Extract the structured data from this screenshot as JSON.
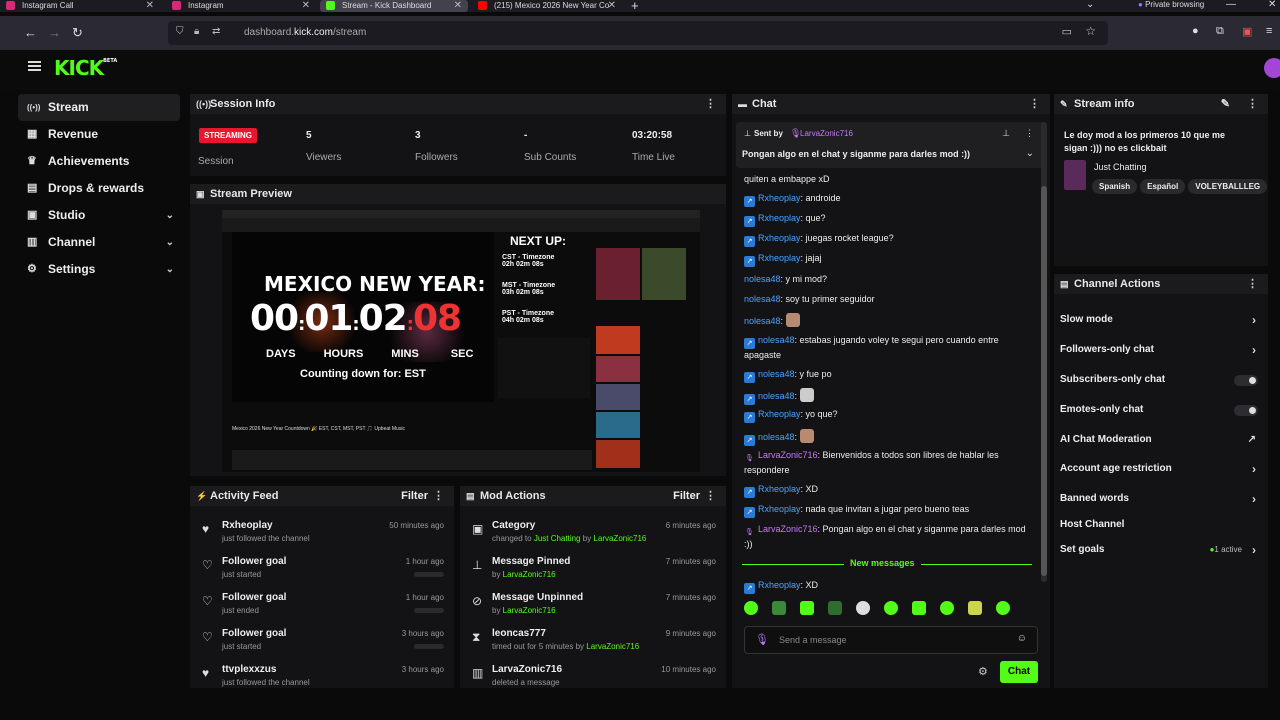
{
  "browser": {
    "tabs": [
      {
        "title": "Instagram Call",
        "color": "#d62976"
      },
      {
        "title": "Instagram",
        "color": "#d62976"
      },
      {
        "title": "Stream - Kick Dashboard",
        "color": "#53fc18"
      },
      {
        "title": "(215) Mexico 2026 New Year Co",
        "color": "#ff0000"
      }
    ],
    "private_label": "Private browsing",
    "url_host": "dashboard.",
    "url_domain": "kick.com",
    "url_path": "/stream"
  },
  "header": {
    "logo": "KICK",
    "logo_sup": "BETA"
  },
  "sidebar": {
    "items": [
      {
        "label": "Stream",
        "icon": "stream-icon",
        "glyph": "((•))"
      },
      {
        "label": "Revenue",
        "icon": "revenue-icon",
        "glyph": "▦"
      },
      {
        "label": "Achievements",
        "icon": "trophy-icon",
        "glyph": "🏆"
      },
      {
        "label": "Drops & rewards",
        "icon": "gift-icon",
        "glyph": "🎁"
      },
      {
        "label": "Studio",
        "icon": "studio-icon",
        "glyph": "▣"
      },
      {
        "label": "Channel",
        "icon": "channel-icon",
        "glyph": "▤"
      },
      {
        "label": "Settings",
        "icon": "gear-icon",
        "glyph": "⚙"
      }
    ]
  },
  "session": {
    "title": "Session Info",
    "badge": "STREAMING",
    "session_label": "Session",
    "stats": [
      {
        "value": "5",
        "label": "Viewers"
      },
      {
        "value": "3",
        "label": "Followers"
      },
      {
        "value": "-",
        "label": "Sub Counts"
      },
      {
        "value": "03:20:58",
        "label": "Time Live"
      }
    ]
  },
  "preview": {
    "title": "Stream Preview",
    "headline": "MEXICO NEW YEAR:",
    "countdown": [
      "00",
      "01",
      "02",
      "08"
    ],
    "units": [
      "DAYS",
      "HOURS",
      "MINS",
      "SEC"
    ],
    "counting": "Counting down for: EST",
    "next_up": "NEXT UP:",
    "zones": [
      {
        "name": "CST - Timezone",
        "time": "02h 02m 08s"
      },
      {
        "name": "MST - Timezone",
        "time": "03h 02m 08s"
      },
      {
        "name": "PST - Timezone",
        "time": "04h 02m 08s"
      }
    ],
    "video_title": "Mexico 2026 New Year Countdown 🎉 EST, CST, MST, PST 🎵 Upbeat Music"
  },
  "activity": {
    "title": "Activity Feed",
    "filter": "Filter",
    "items": [
      {
        "title": "Rxheoplay",
        "sub": "just followed the channel",
        "time": "50 minutes ago",
        "icon": "heart-filled-icon",
        "glyph": "♥"
      },
      {
        "title": "Follower goal",
        "sub": "just started",
        "time": "1 hour ago",
        "icon": "heart-icon",
        "glyph": "♡"
      },
      {
        "title": "Follower goal",
        "sub": "just ended",
        "time": "1 hour ago",
        "icon": "heart-icon",
        "glyph": "♡"
      },
      {
        "title": "Follower goal",
        "sub": "just started",
        "time": "3 hours ago",
        "icon": "heart-icon",
        "glyph": "♡"
      },
      {
        "title": "ttvplexxzus",
        "sub": "just followed the channel",
        "time": "3 hours ago",
        "icon": "heart-filled-icon",
        "glyph": "♥"
      }
    ]
  },
  "mod": {
    "title": "Mod Actions",
    "filter": "Filter",
    "items": [
      {
        "title": "Category",
        "pre": "changed to ",
        "hl1": "Just Chatting",
        "mid": " by ",
        "hl2": "LarvaZonic716",
        "time": "6 minutes ago",
        "icon": "category-icon",
        "glyph": "▣"
      },
      {
        "title": "Message Pinned",
        "pre": "by ",
        "hl1": "LarvaZonic716",
        "mid": "",
        "hl2": "",
        "time": "7 minutes ago",
        "icon": "pin-icon",
        "glyph": "📌"
      },
      {
        "title": "Message Unpinned",
        "pre": "by ",
        "hl1": "LarvaZonic716",
        "mid": "",
        "hl2": "",
        "time": "7 minutes ago",
        "icon": "unpin-icon",
        "glyph": "⊘"
      },
      {
        "title": "leoncas777",
        "pre": "timed out for 5 minutes by ",
        "hl1": "LarvaZonic716",
        "mid": "",
        "hl2": "",
        "time": "9 minutes ago",
        "icon": "hourglass-icon",
        "glyph": "⧗"
      },
      {
        "title": "LarvaZonic716",
        "pre": "deleted a message",
        "hl1": "",
        "mid": "",
        "hl2": "",
        "time": "10 minutes ago",
        "icon": "trash-icon",
        "glyph": "🗑"
      }
    ]
  },
  "chat": {
    "title": "Chat",
    "pinned_label": "Sent by",
    "pinned_user": "LarvaZonic716",
    "pinned_text": "Pongan algo en el chat y siganme para darles mod :))",
    "messages": [
      {
        "user": "",
        "text": "quiten a embappe xD",
        "badge": "none",
        "color": "blue"
      },
      {
        "user": "Rxheoplay",
        "text": ": androide",
        "badge": "blue",
        "color": "blue"
      },
      {
        "user": "Rxheoplay",
        "text": ": que?",
        "badge": "blue",
        "color": "blue"
      },
      {
        "user": "Rxheoplay",
        "text": ": juegas rocket league?",
        "badge": "blue",
        "color": "blue"
      },
      {
        "user": "Rxheoplay",
        "text": ": jajaj",
        "badge": "blue",
        "color": "blue"
      },
      {
        "user": "nolesa48",
        "text": ": y mi mod?",
        "badge": "none",
        "color": "blue"
      },
      {
        "user": "nolesa48",
        "text": ": soy tu primer seguidor",
        "badge": "none",
        "color": "blue"
      },
      {
        "user": "nolesa48",
        "text": ":",
        "badge": "none",
        "color": "blue",
        "emote": true
      },
      {
        "user": "nolesa48",
        "text": ": estabas jugando voley te segui pero cuando entre apagaste",
        "badge": "blue",
        "color": "blue"
      },
      {
        "user": "nolesa48",
        "text": ": y fue po",
        "badge": "blue",
        "color": "blue"
      },
      {
        "user": "nolesa48",
        "text": ":",
        "badge": "blue",
        "color": "blue",
        "emote": true
      },
      {
        "user": "Rxheoplay",
        "text": ": yo que?",
        "badge": "blue",
        "color": "blue"
      },
      {
        "user": "nolesa48",
        "text": ":",
        "badge": "blue",
        "color": "blue",
        "emote": true
      },
      {
        "user": "LarvaZonic716",
        "text": ": Bienvenidos a todos son libres de hablar les respondere",
        "badge": "purple",
        "color": "purple"
      },
      {
        "user": "Rxheoplay",
        "text": ": XD",
        "badge": "blue",
        "color": "blue"
      },
      {
        "user": "Rxheoplay",
        "text": ": nada que invitan a jugar pero bueno teas",
        "badge": "blue",
        "color": "blue"
      },
      {
        "user": "LarvaZonic716",
        "text": ": Pongan algo en el chat y siganme para darles mod :))",
        "badge": "purple",
        "color": "purple"
      }
    ],
    "new_messages": "New messages",
    "last_message": {
      "user": "Rxheoplay",
      "text": ": XD"
    },
    "placeholder": "Send a message",
    "send": "Chat"
  },
  "stream_info": {
    "title": "Stream info",
    "stream_title": "Le doy mod a los primeros 10 que me sigan :))) no es clickbait",
    "category": "Just Chatting",
    "tags": [
      "Spanish",
      "Español",
      "VOLEYBALLLEG"
    ]
  },
  "actions": {
    "title": "Channel Actions",
    "items": [
      {
        "label": "Slow mode",
        "kind": "arrow"
      },
      {
        "label": "Followers-only chat",
        "kind": "arrow"
      },
      {
        "label": "Subscribers-only chat",
        "kind": "toggle"
      },
      {
        "label": "Emotes-only chat",
        "kind": "toggle"
      },
      {
        "label": "AI Chat Moderation",
        "kind": "external"
      },
      {
        "label": "Account age restriction",
        "kind": "arrow"
      },
      {
        "label": "Banned words",
        "kind": "arrow"
      },
      {
        "label": "Host Channel",
        "kind": "none"
      },
      {
        "label": "Set goals",
        "kind": "arrow",
        "status": "1 active"
      }
    ]
  },
  "colors": {
    "accent": "#53fc18",
    "live": "#e8172d",
    "username": "#4aa3ff",
    "mod": "#c678ff"
  }
}
